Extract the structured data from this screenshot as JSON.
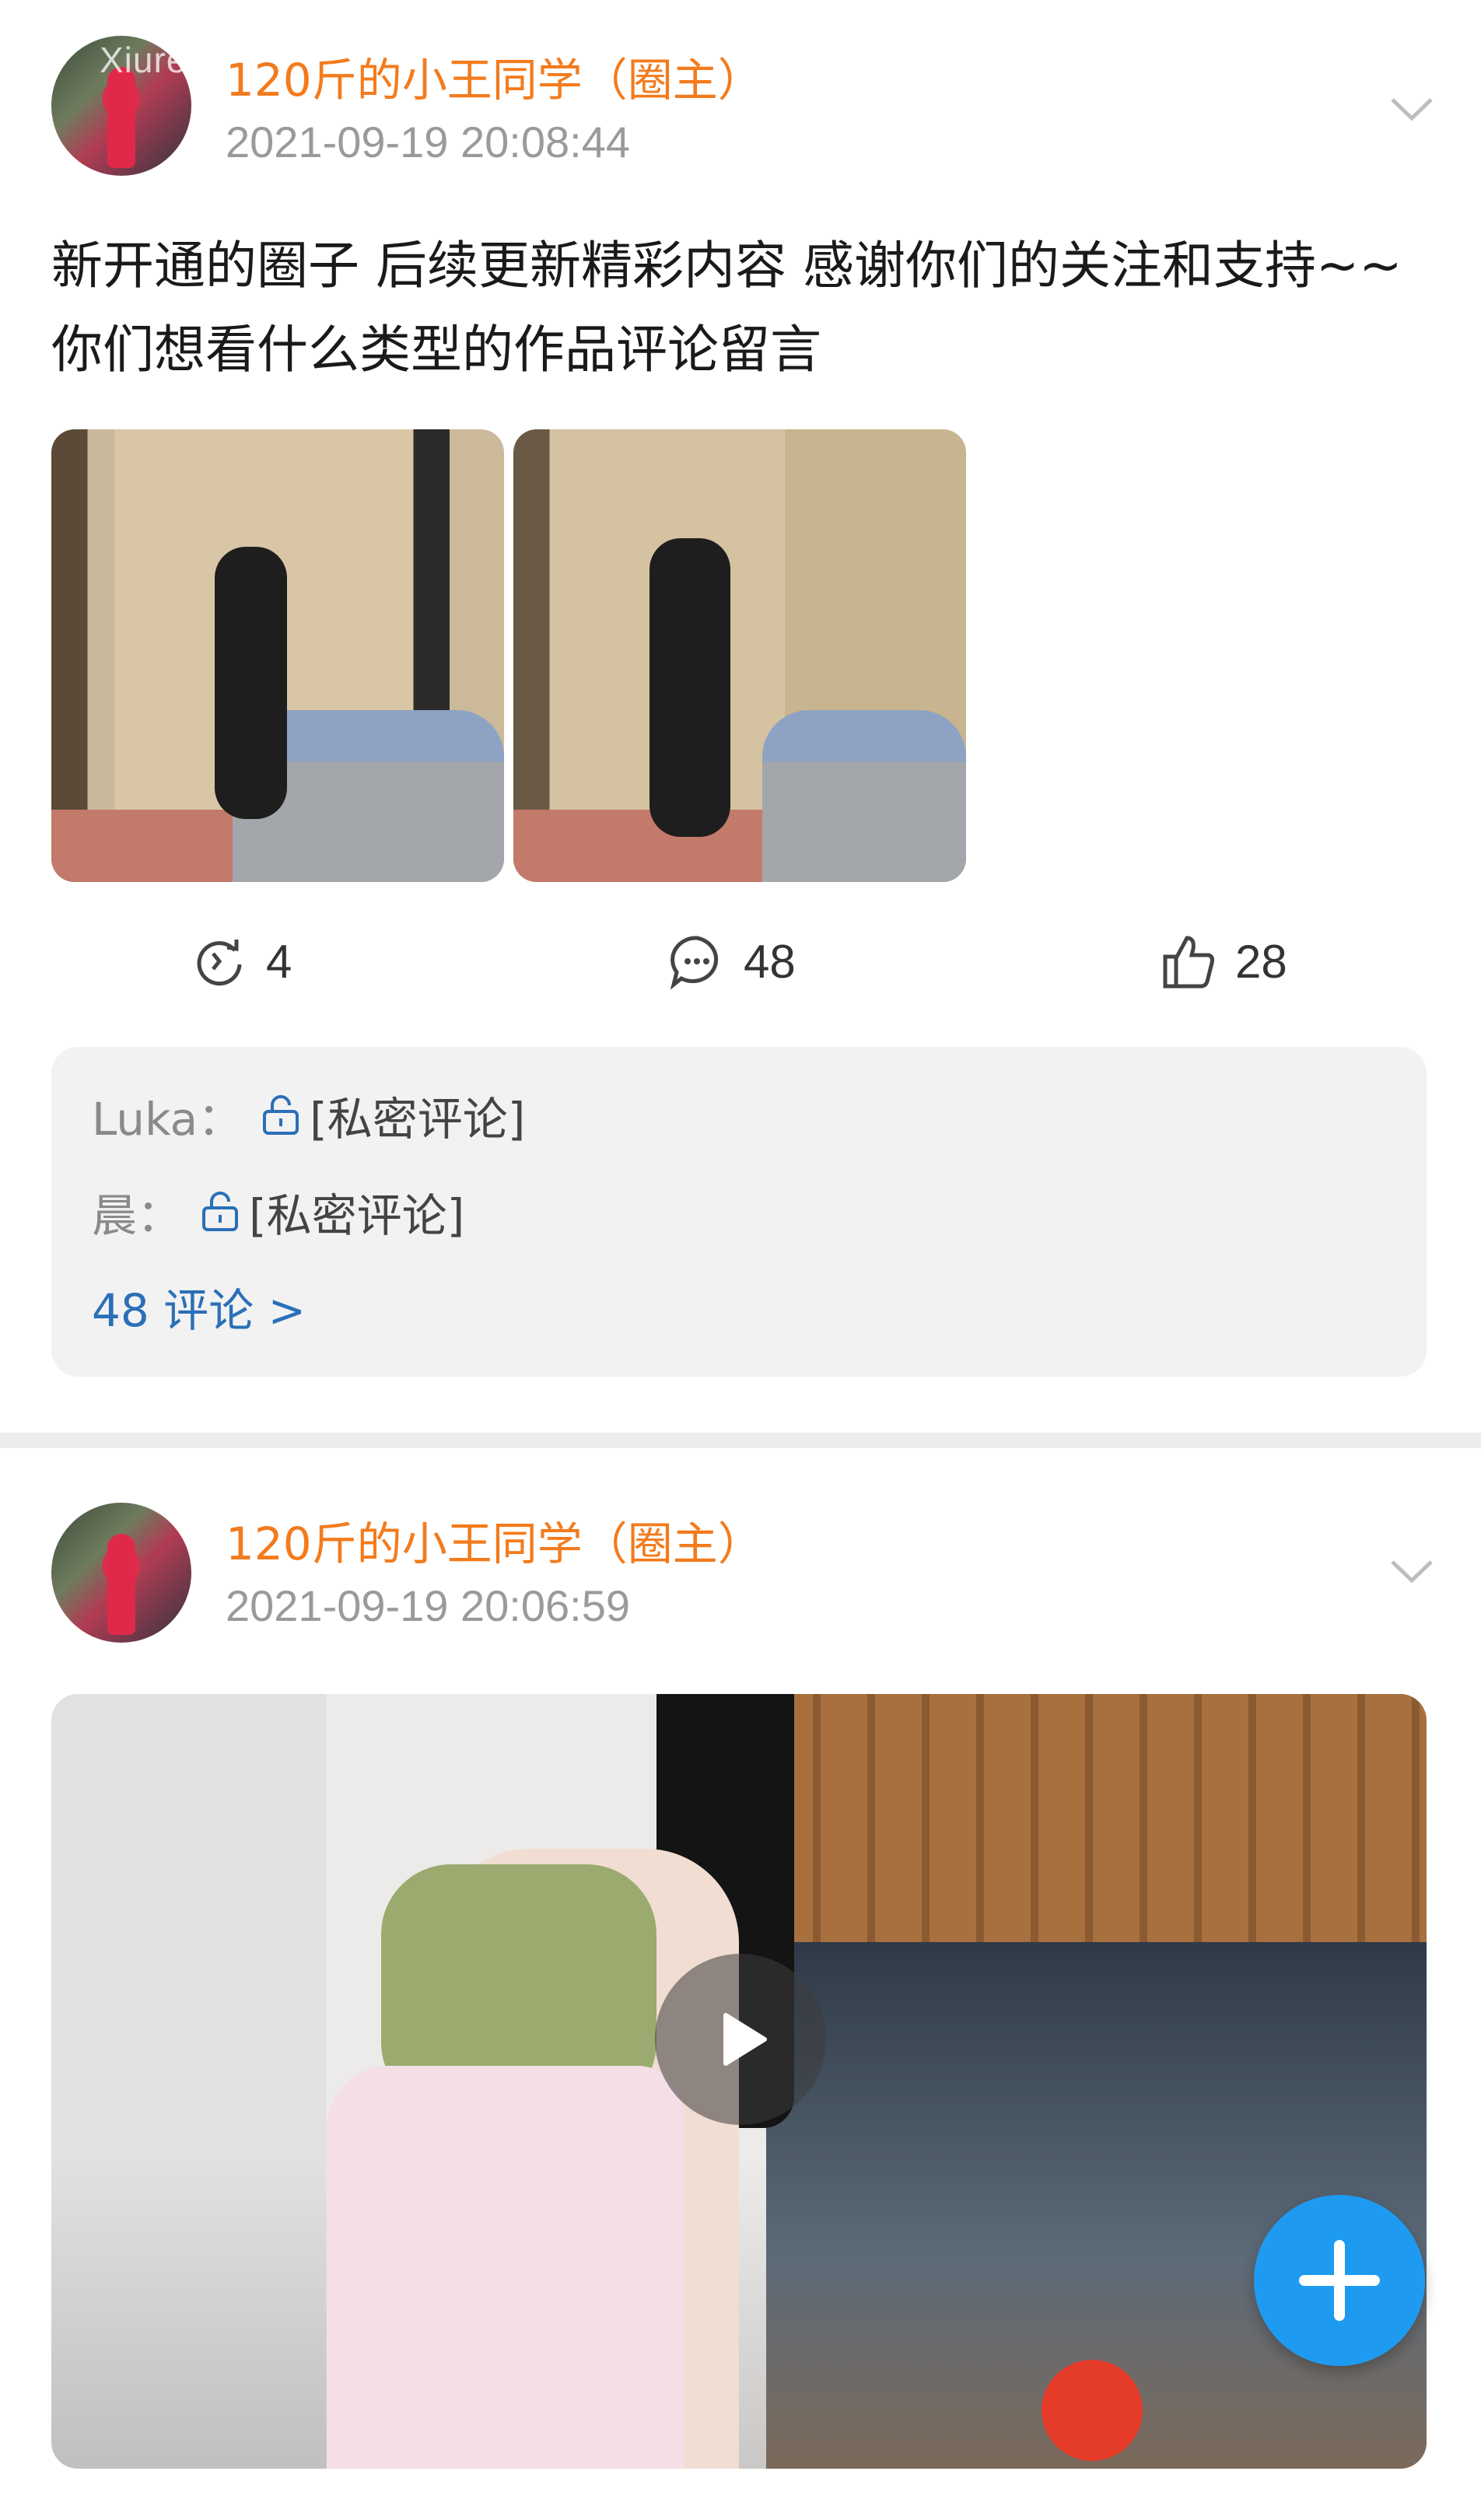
{
  "watermark": "Xiuren",
  "posts": [
    {
      "author": "120斤的小王同学（圈主）",
      "time": "2021-09-19 20:08:44",
      "text": "新开通的圈子 后续更新精彩内容 感谢你们的关注和支持~~你们想看什么类型的作品评论留言",
      "images": [
        "photo-thumbnail",
        "photo-thumbnail"
      ],
      "actions": {
        "repost_count": "4",
        "comment_count": "48",
        "like_count": "28"
      },
      "comments": [
        {
          "name": "Luka：",
          "text": "[私密评论]"
        },
        {
          "name": "晨：",
          "text": "[私密评论]"
        }
      ],
      "comments_more": "48 评论 >"
    },
    {
      "author": "120斤的小王同学（圈主）",
      "time": "2021-09-19 20:06:59",
      "media": "video"
    }
  ],
  "colors": {
    "author": "#f37b1d",
    "time": "#9a9a9a",
    "link": "#2b6fb7",
    "fab": "#1e9bf0",
    "comment_bg": "#f2f2f2"
  },
  "icons": {
    "repost": "repost-icon",
    "comment": "comment-icon",
    "like": "like-icon",
    "lock": "lock-icon",
    "more": "chevron-down-icon",
    "play": "play-icon",
    "add": "plus-icon"
  }
}
